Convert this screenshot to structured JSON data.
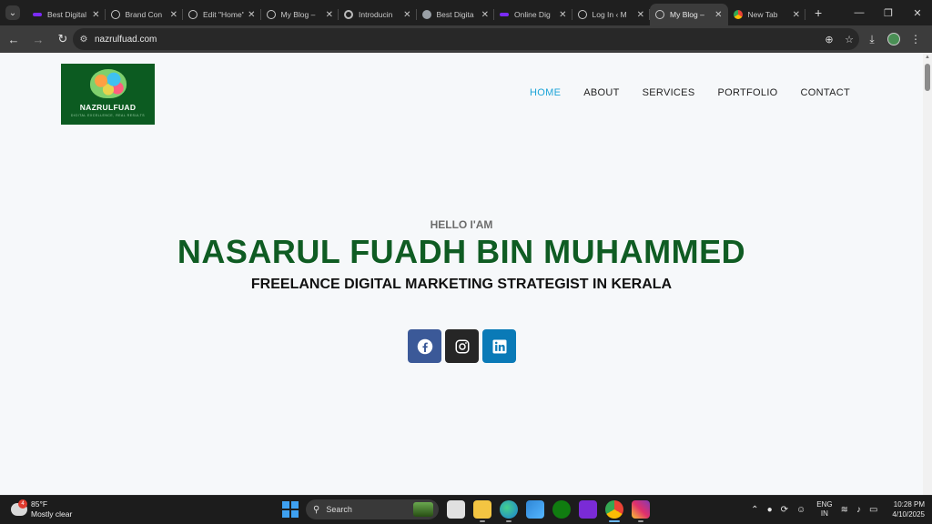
{
  "browser": {
    "tabs": [
      {
        "title": "Best Digital",
        "favicon": "purple-bar-icon",
        "active": false
      },
      {
        "title": "Brand Con",
        "favicon": "globe-icon",
        "active": false
      },
      {
        "title": "Edit \"Home\"",
        "favicon": "globe-icon",
        "active": false
      },
      {
        "title": "My Blog –",
        "favicon": "globe-icon",
        "active": false
      },
      {
        "title": "Introducin",
        "favicon": "openai-icon",
        "active": false
      },
      {
        "title": "Best Digita",
        "favicon": "gray-circle-icon",
        "active": false
      },
      {
        "title": "Online Dig",
        "favicon": "purple-bar-icon",
        "active": false
      },
      {
        "title": "Log In ‹ M",
        "favicon": "globe-icon",
        "active": false
      },
      {
        "title": "My Blog –",
        "favicon": "globe-icon",
        "active": true
      },
      {
        "title": "New Tab",
        "favicon": "chrome-icon",
        "active": false
      }
    ],
    "url": "nazrulfuad.com"
  },
  "site": {
    "logo": {
      "text": "NAZRULFUAD",
      "tagline": "DIGITAL EXCELLENCE, REAL RESULTS"
    },
    "nav": [
      "HOME",
      "ABOUT",
      "SERVICES",
      "PORTFOLIO",
      "CONTACT"
    ],
    "active_nav": "HOME",
    "hero": {
      "eyebrow": "HELLO I'AM",
      "name": "NASARUL FUADH BIN MUHAMMED",
      "subtitle": "FREELANCE DIGITAL MARKETING STRATEGIST IN KERALA"
    },
    "socials": [
      "facebook-icon",
      "instagram-icon",
      "linkedin-icon"
    ]
  },
  "taskbar": {
    "weather": {
      "temp": "85°F",
      "condition": "Mostly clear",
      "badge": "4"
    },
    "search_label": "Search",
    "language": {
      "line1": "ENG",
      "line2": "IN"
    },
    "clock": {
      "time": "10:28 PM",
      "date": "4/10/2025"
    }
  },
  "colors": {
    "brand_green": "#0f5c23",
    "nav_active": "#1ea5d8",
    "facebook": "#3b5998",
    "instagram": "#262626",
    "linkedin": "#0a7ab7"
  }
}
